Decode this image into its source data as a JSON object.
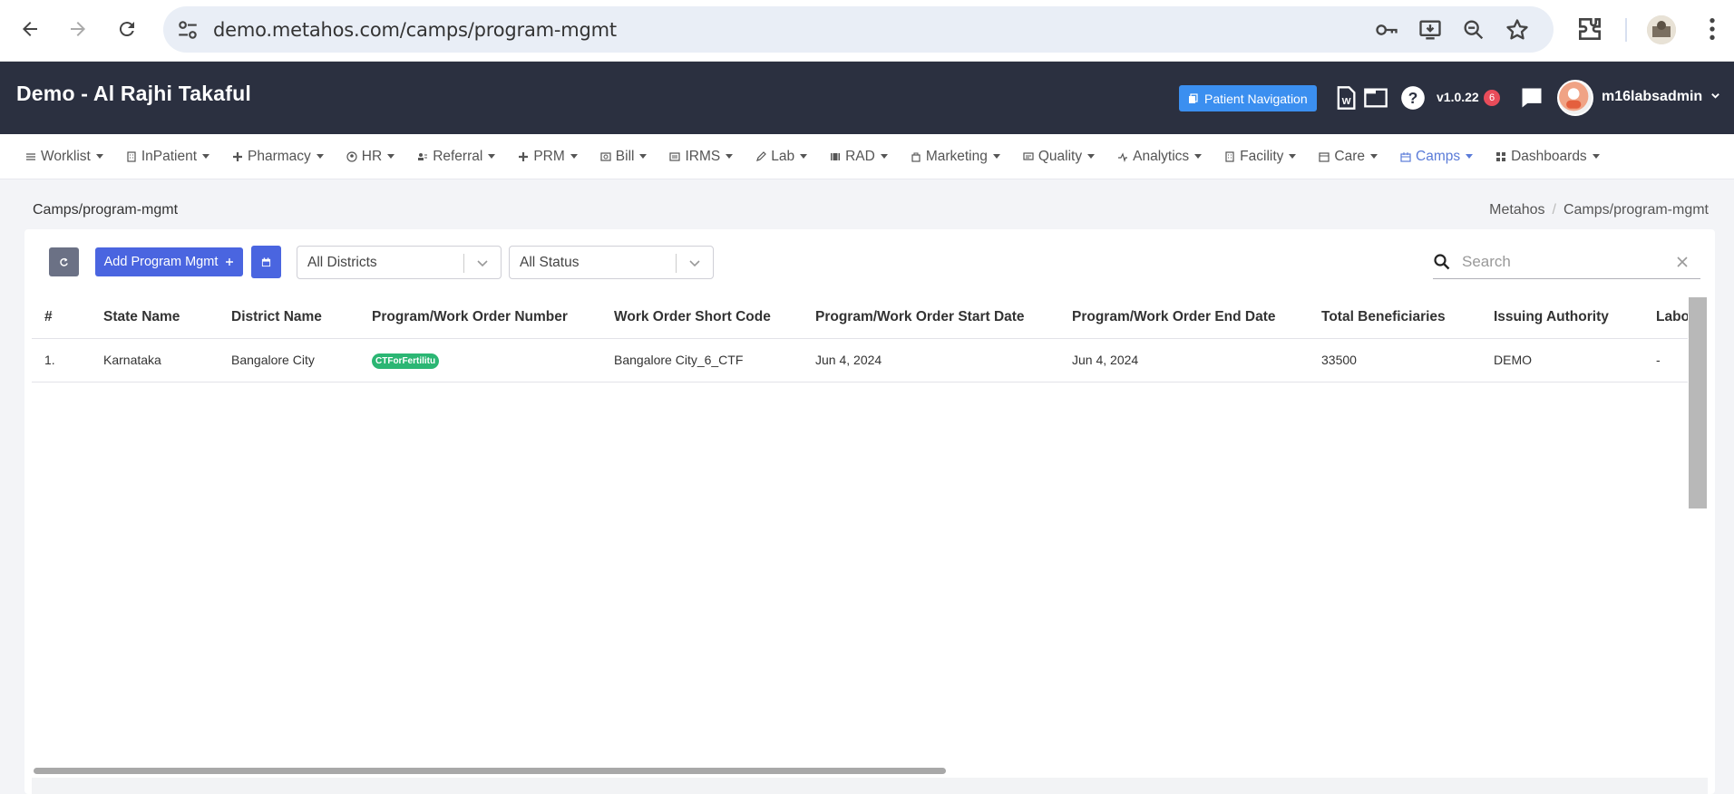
{
  "browser": {
    "url": "demo.metahos.com/camps/program-mgmt"
  },
  "header": {
    "title": "Demo - Al Rajhi Takaful",
    "patient_navigation": "Patient Navigation",
    "version": "v1.0.22",
    "notification_count": "6",
    "username": "m16labsadmin"
  },
  "menu": [
    {
      "label": "Worklist",
      "icon": "list-icon"
    },
    {
      "label": "InPatient",
      "icon": "building-icon"
    },
    {
      "label": "Pharmacy",
      "icon": "plus-icon"
    },
    {
      "label": "HR",
      "icon": "user-circle-icon"
    },
    {
      "label": "Referral",
      "icon": "users-icon"
    },
    {
      "label": "PRM",
      "icon": "plus-icon"
    },
    {
      "label": "Bill",
      "icon": "money-icon"
    },
    {
      "label": "IRMS",
      "icon": "list-box-icon"
    },
    {
      "label": "Lab",
      "icon": "pen-icon"
    },
    {
      "label": "RAD",
      "icon": "film-icon"
    },
    {
      "label": "Marketing",
      "icon": "bag-icon"
    },
    {
      "label": "Quality",
      "icon": "monitor-icon"
    },
    {
      "label": "Analytics",
      "icon": "pulse-icon"
    },
    {
      "label": "Facility",
      "icon": "building-icon"
    },
    {
      "label": "Care",
      "icon": "calendar-icon"
    },
    {
      "label": "Camps",
      "icon": "camp-icon"
    },
    {
      "label": "Dashboards",
      "icon": "grid-icon"
    }
  ],
  "page": {
    "title": "Camps/program-mgmt",
    "breadcrumb_root": "Metahos",
    "breadcrumb_current": "Camps/program-mgmt"
  },
  "toolbar": {
    "add_label": "Add Program Mgmt",
    "district_filter": "All Districts",
    "status_filter": "All Status",
    "search_placeholder": "Search"
  },
  "table": {
    "columns": [
      "#",
      "State Name",
      "District Name",
      "Program/Work Order Number",
      "Work Order Short Code",
      "Program/Work Order Start Date",
      "Program/Work Order End Date",
      "Total Beneficiaries",
      "Issuing Authority",
      "Labo"
    ],
    "rows": [
      [
        "1.",
        "Karnataka",
        "Bangalore City",
        "CTForFertilitu",
        "Bangalore City_6_CTF",
        "Jun 4, 2024",
        "Jun 4, 2024",
        "33500",
        "DEMO",
        "-"
      ]
    ]
  },
  "colors": {
    "header_bg": "#2b3040",
    "primary": "#4a65e0",
    "badge": "#2bb673",
    "active_menu": "#5a7bd8"
  }
}
